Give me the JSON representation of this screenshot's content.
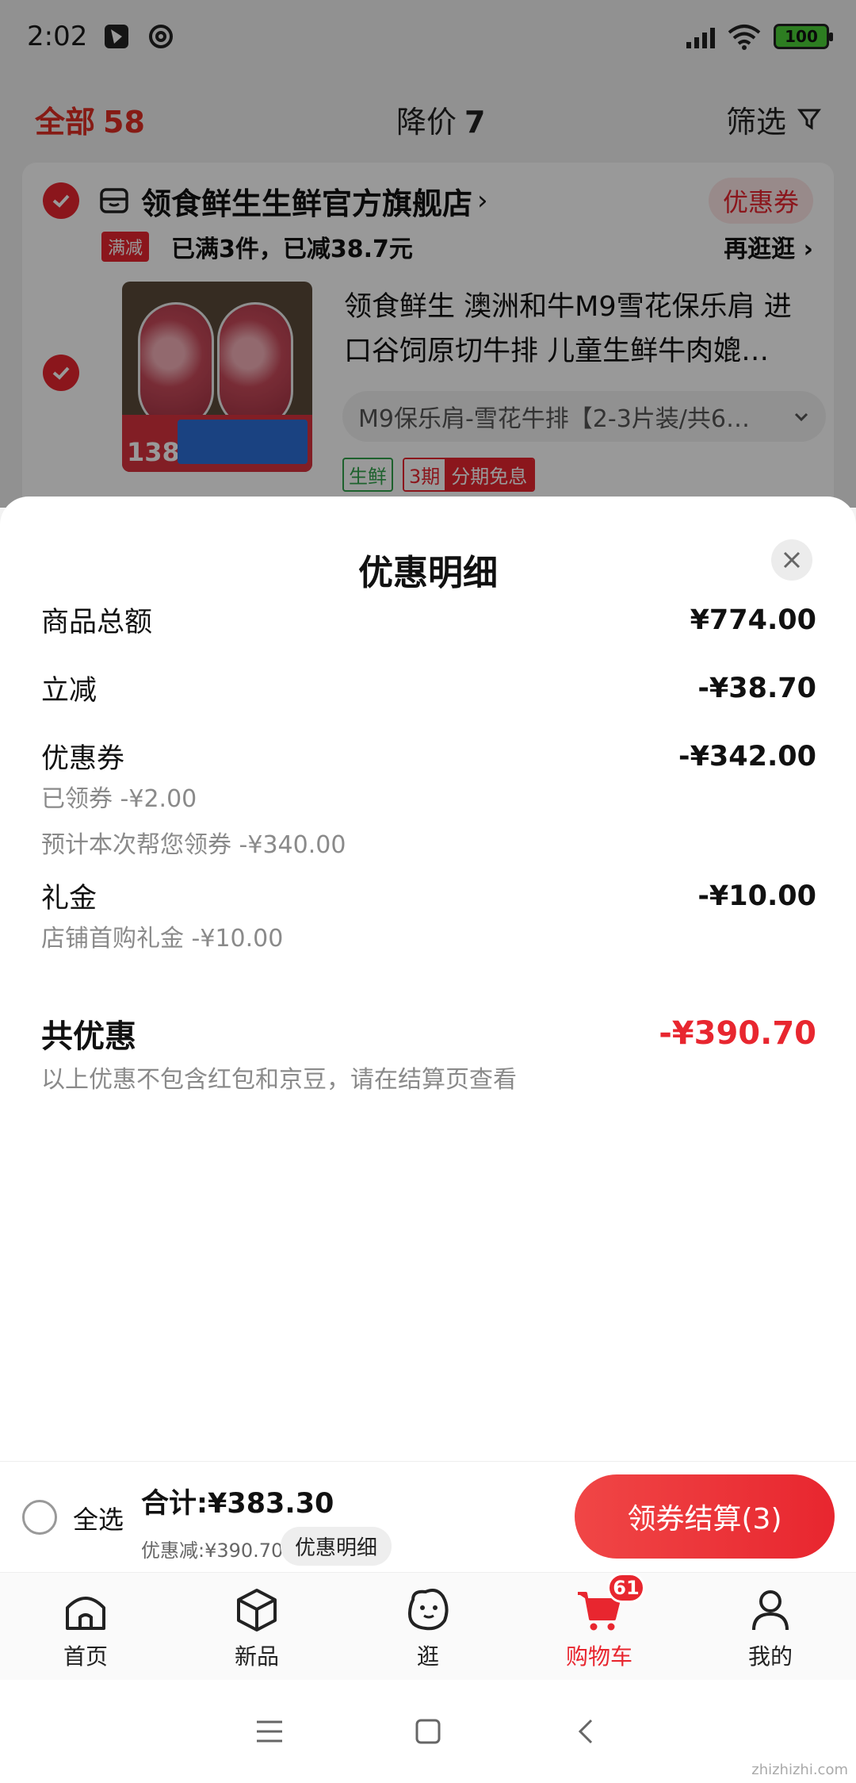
{
  "status_bar": {
    "time": "2:02",
    "battery": "100"
  },
  "filter_bar": {
    "all_label": "全部",
    "all_count": "58",
    "drop_label": "降价",
    "drop_count": "7",
    "screen_label": "筛选"
  },
  "shop": {
    "name": "领食鲜生生鲜官方旗舰店",
    "arrow": "›",
    "coupon_tag": "优惠券",
    "promo_badge": "满减",
    "promo_text": "已满3件，已减38.7元",
    "promo_more": "再逛逛 ›"
  },
  "item": {
    "title": "领食鲜生 澳洲和牛M9雪花保乐肩 进口谷饲原切牛排 儿童生鲜牛肉媲…",
    "sku": "M9保乐肩-雪花牛排【2-3片装/共6…",
    "thumb_price": "138",
    "tag_fresh": "生鲜",
    "tag_install_a": "3期",
    "tag_install_b": "分期免息"
  },
  "sheet": {
    "title": "优惠明细",
    "rows": [
      {
        "label": "商品总额",
        "value": "¥774.00"
      },
      {
        "label": "立减",
        "value": "-¥38.70"
      },
      {
        "label": "优惠券",
        "value": "-¥342.00"
      },
      {
        "label": "礼金",
        "value": "-¥10.00"
      }
    ],
    "coupon_sub_1": "已领券 -¥2.00",
    "coupon_sub_2": "预计本次帮您领券 -¥340.00",
    "gift_sub": "店铺首购礼金 -¥10.00",
    "total_label": "共优惠",
    "total_value": "-¥390.70",
    "note": "以上优惠不包含红包和京豆，请在结算页查看"
  },
  "checkout": {
    "select_all": "全选",
    "sum": "合计:¥383.30",
    "saved": "优惠减:¥390.70",
    "detail_chip": "优惠明细",
    "button": "领券结算(3)"
  },
  "tabbar": {
    "items": [
      {
        "label": "首页",
        "icon": "home-icon"
      },
      {
        "label": "新品",
        "icon": "cube-icon"
      },
      {
        "label": "逛",
        "icon": "face-icon"
      },
      {
        "label": "购物车",
        "icon": "cart-icon"
      },
      {
        "label": "我的",
        "icon": "user-icon"
      }
    ],
    "cart_badge": "61"
  },
  "colors": {
    "accent": "#e8262f",
    "muted": "#8a8a8a"
  },
  "watermark": "zhizhizhi.com"
}
